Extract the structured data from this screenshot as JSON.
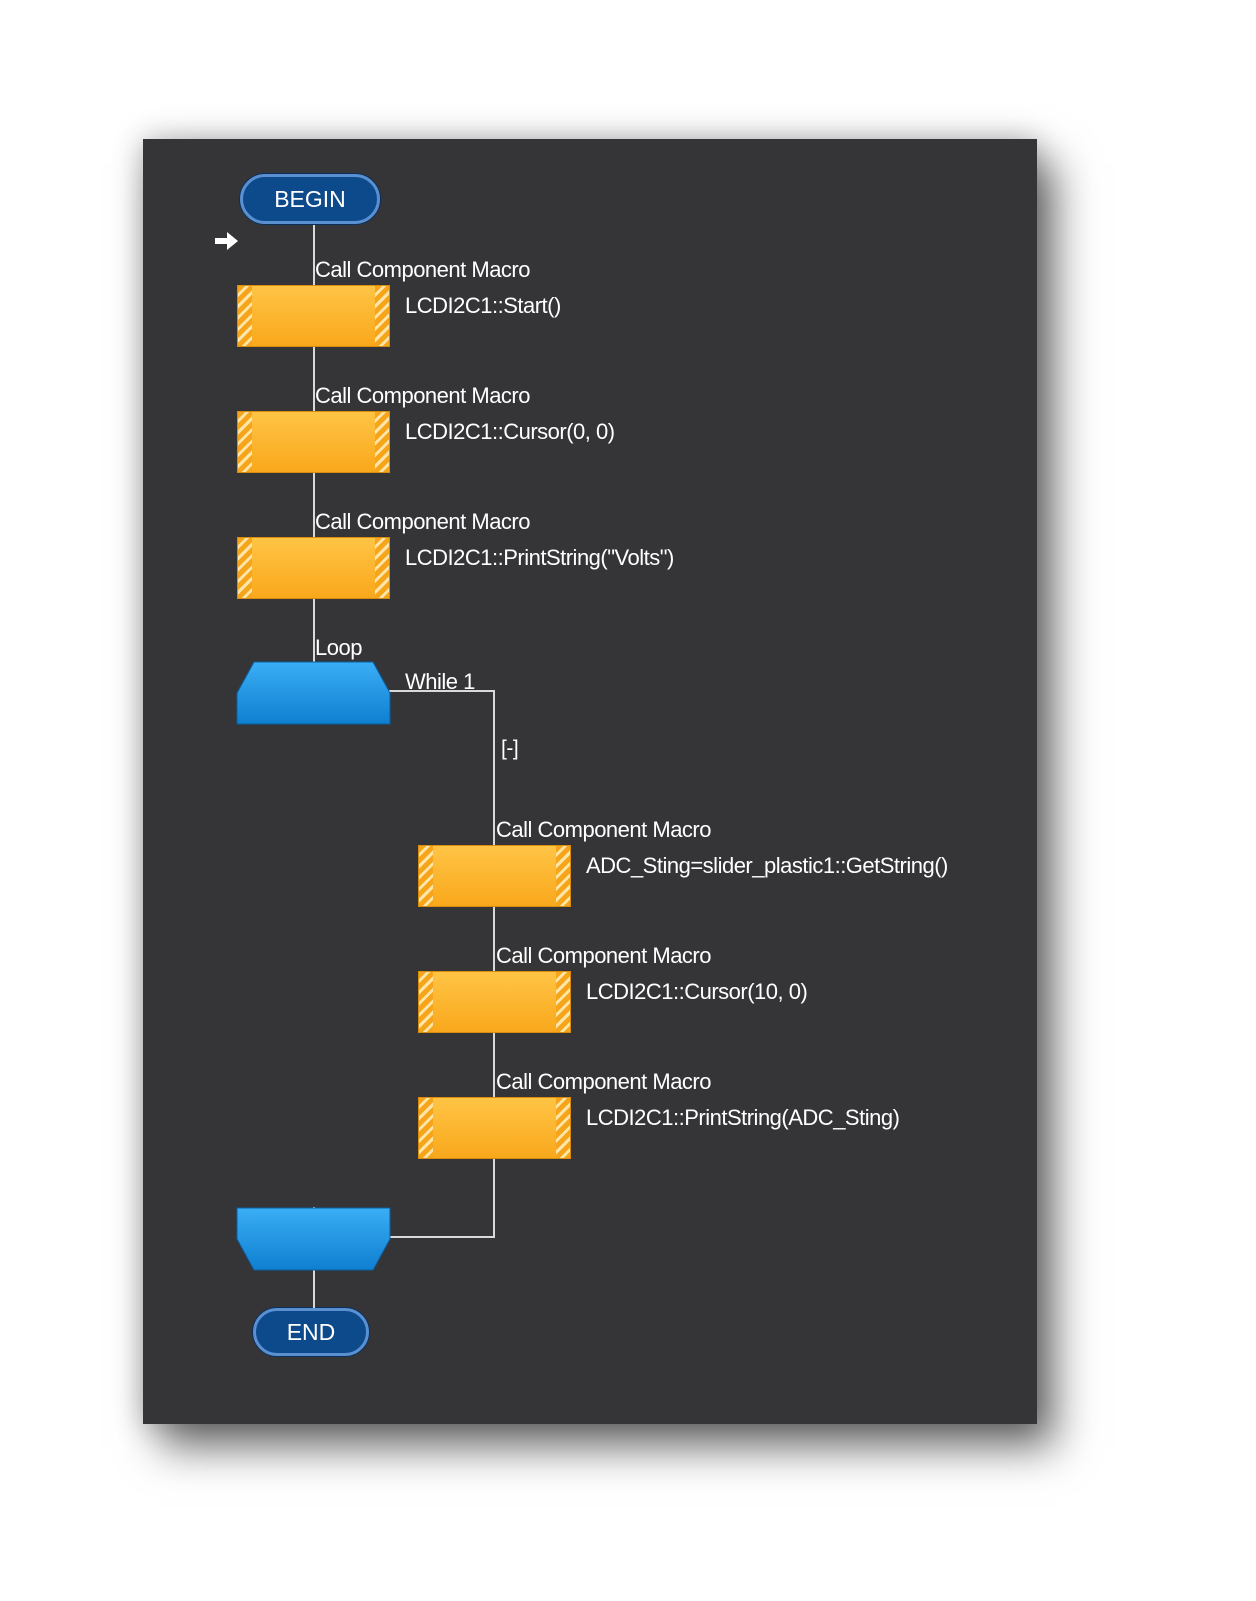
{
  "flowchart": {
    "begin_label": "BEGIN",
    "end_label": "END",
    "blocks": [
      {
        "type_label": "Call Component Macro",
        "expression": "LCDI2C1::Start()"
      },
      {
        "type_label": "Call Component Macro",
        "expression": "LCDI2C1::Cursor(0, 0)"
      },
      {
        "type_label": "Call Component Macro",
        "expression": "LCDI2C1::PrintString(\"Volts\")"
      }
    ],
    "loop": {
      "label": "Loop",
      "condition": "While 1",
      "collapse_toggle": "[-]",
      "body": [
        {
          "type_label": "Call Component Macro",
          "expression": "ADC_Sting=slider_plastic1::GetString()"
        },
        {
          "type_label": "Call Component Macro",
          "expression": "LCDI2C1::Cursor(10, 0)"
        },
        {
          "type_label": "Call Component Macro",
          "expression": "LCDI2C1::PrintString(ADC_Sting)"
        }
      ]
    }
  },
  "colors": {
    "canvas": "#353538",
    "terminal": "#0d4a8c",
    "macro_block": "#ffb534",
    "loop_block": "#1a8fe0",
    "connector": "#d9d9d9"
  },
  "icons": {
    "execution_pointer": "arrow-right-icon"
  }
}
